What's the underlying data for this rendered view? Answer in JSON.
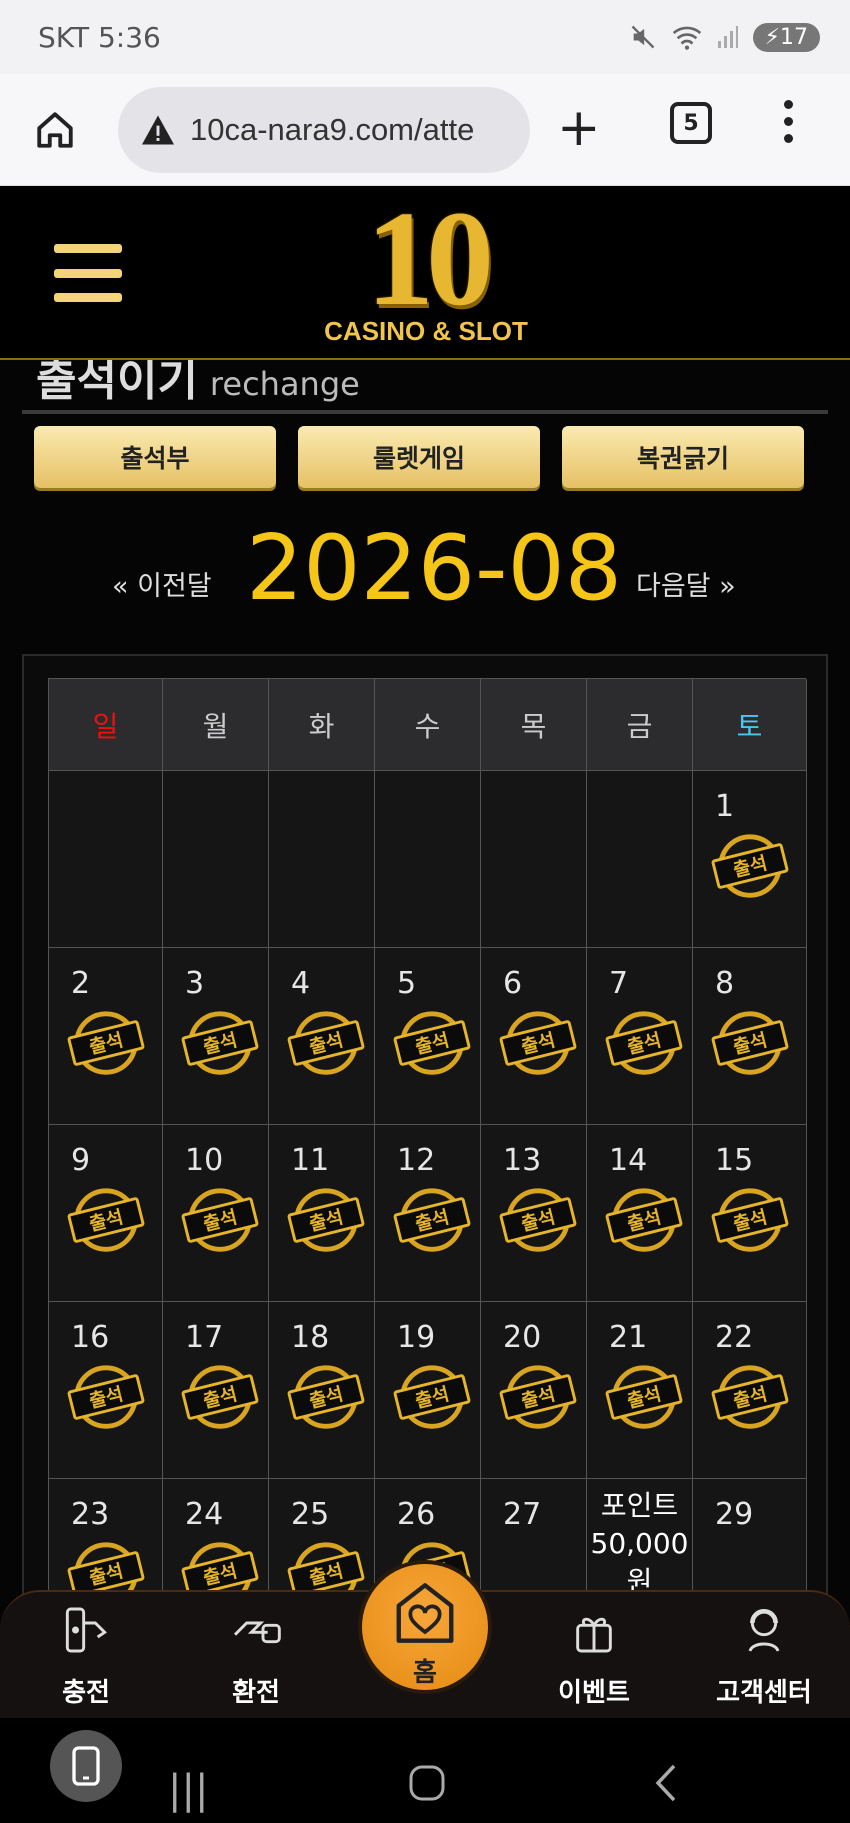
{
  "status_bar": {
    "carrier_time": "SKT 5:36",
    "battery": "17"
  },
  "browser": {
    "url": "10ca-nara9.com/atte",
    "tab_count": "5"
  },
  "header": {
    "logo_number": "10",
    "logo_subtitle": "CASINO & SLOT"
  },
  "section": {
    "title_ko": "출석이기",
    "title_en": "rechange"
  },
  "tabs": [
    {
      "label": "출석부"
    },
    {
      "label": "룰렛게임"
    },
    {
      "label": "복권긁기"
    }
  ],
  "month_nav": {
    "prev": "« 이전달",
    "current": "2026-08",
    "next": "다음달 »"
  },
  "calendar": {
    "weekdays": [
      "일",
      "월",
      "화",
      "수",
      "목",
      "금",
      "토"
    ],
    "stamp_text": "출석",
    "point_note": {
      "line1": "포인트",
      "line2": "50,000",
      "line3": "원"
    }
  },
  "bottom_nav": [
    {
      "label": "충전"
    },
    {
      "label": "환전"
    },
    {
      "label": "홈"
    },
    {
      "label": "이벤트"
    },
    {
      "label": "고객센터"
    }
  ],
  "colors": {
    "gold": "#f5c518",
    "button_gold": "#f0d27a",
    "home_orange": "#f29a22",
    "sunday": "#e11111",
    "saturday": "#4cc6f0"
  }
}
